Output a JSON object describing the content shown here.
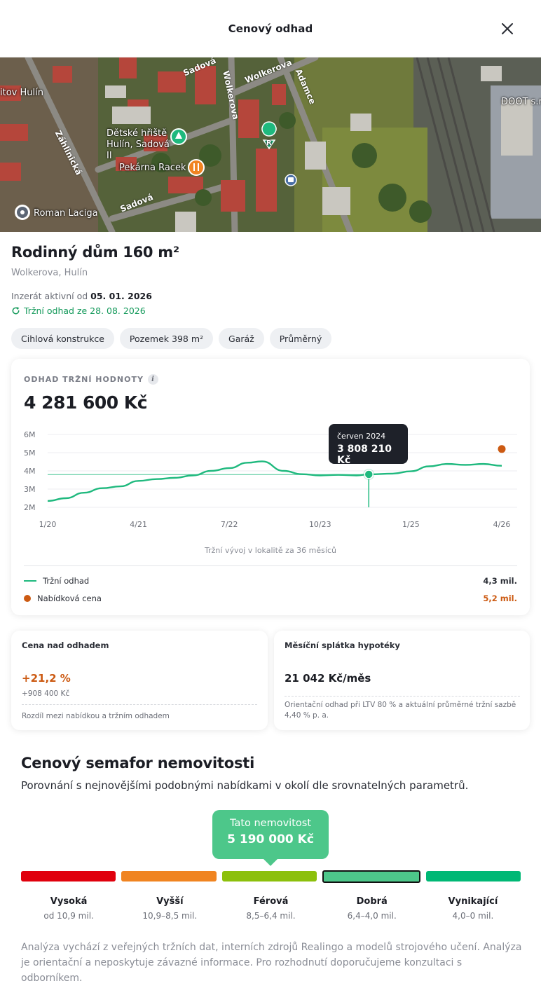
{
  "header": {
    "title": "Cenový odhad"
  },
  "map": {
    "labels": {
      "playground": "Dětské hřiště Hulín, Sadová II",
      "bakery": "Pekárna Racek",
      "person": "Roman Laciga",
      "left_place": "itov Hulín",
      "company": "DOOT s.r"
    },
    "streets": {
      "zahlinicka": "Záhlinická",
      "sadova_top": "Sadová",
      "wolkerova_1": "Wolkerova",
      "wolkerova_2": "Wolkerova",
      "adamce": "Adamce",
      "sadova_bottom": "Sadová"
    },
    "marker_letter": "R"
  },
  "listing": {
    "title": "Rodinný dům 160 m²",
    "address": "Wolkerova, Hulín",
    "active_prefix": "Inzerát aktivní od",
    "active_date": "05. 01. 2026",
    "estimate_text": "Tržní odhad ze 28. 08. 2026"
  },
  "chips": [
    "Cihlová konstrukce",
    "Pozemek 398 m²",
    "Garáž",
    "Průměrný"
  ],
  "valuation": {
    "label": "ODHAD TRŽNÍ HODNOTY",
    "info_glyph": "i",
    "value": "4 281 600 Kč",
    "caption": "Tržní vývoj v lokalitě za 36 měsíců",
    "legend": [
      {
        "name": "Tržní odhad",
        "value": "4,3 mil."
      },
      {
        "name": "Nabídková cena",
        "value": "5,2 mil."
      }
    ],
    "tooltip": {
      "date": "červen 2024",
      "value": "3 808 210 Kč"
    }
  },
  "chart_data": {
    "type": "line",
    "y_ticks": [
      "6M",
      "5M",
      "4M",
      "3M",
      "2M"
    ],
    "y_tick_values": [
      6,
      5,
      4,
      3,
      2
    ],
    "ylim": [
      2,
      6
    ],
    "x_ticks": [
      "1/20",
      "4/21",
      "7/22",
      "10/23",
      "1/25",
      "4/26"
    ],
    "xlim": [
      2020.0,
      2026.25
    ],
    "grid": true,
    "series": [
      {
        "name": "Tržní odhad",
        "color": "#1fb97e",
        "points": [
          [
            2020.0,
            2.35
          ],
          [
            2020.25,
            2.5
          ],
          [
            2020.5,
            2.8
          ],
          [
            2020.75,
            3.05
          ],
          [
            2021.0,
            3.15
          ],
          [
            2021.25,
            3.45
          ],
          [
            2021.5,
            3.55
          ],
          [
            2021.75,
            3.62
          ],
          [
            2022.0,
            3.75
          ],
          [
            2022.25,
            4.0
          ],
          [
            2022.5,
            4.15
          ],
          [
            2022.75,
            4.45
          ],
          [
            2022.95,
            4.52
          ],
          [
            2023.25,
            4.0
          ],
          [
            2023.5,
            3.82
          ],
          [
            2023.75,
            3.75
          ],
          [
            2024.0,
            3.78
          ],
          [
            2024.25,
            3.75
          ],
          [
            2024.42,
            3.81
          ],
          [
            2024.75,
            3.85
          ],
          [
            2025.0,
            3.98
          ],
          [
            2025.25,
            4.25
          ],
          [
            2025.5,
            4.38
          ],
          [
            2025.75,
            4.33
          ],
          [
            2026.0,
            4.38
          ],
          [
            2026.25,
            4.28
          ]
        ]
      },
      {
        "name": "Nabídková cena",
        "color": "#cc5a12",
        "points": [
          [
            2026.25,
            5.2
          ]
        ]
      }
    ],
    "reference_value": 3.8,
    "highlight": {
      "x": 2024.42,
      "y": 3.81,
      "label": "červen 2024",
      "value": "3 808 210 Kč"
    }
  },
  "stats": {
    "above_estimate": {
      "title": "Cena nad odhadem",
      "percent": "+21,2 %",
      "amount": "+908 400 Kč",
      "note": "Rozdíl mezi nabídkou a tržním odhadem"
    },
    "mortgage": {
      "title": "Měsíční splátka hypotéky",
      "value": "21 042 Kč/měs",
      "note": "Orientační odhad při LTV 80 % a aktuální průměrné tržní sazbě 4,40 % p. a."
    }
  },
  "semaphore": {
    "title": "Cenový semafor nemovitosti",
    "subtitle": "Porovnání s nejnovějšími podobnými nabídkami v okolí dle srovnatelných parametrů.",
    "badge_label": "Tato nemovitost",
    "badge_value": "5 190 000 Kč",
    "selected_index": 3,
    "levels": [
      {
        "name": "Vysoká",
        "range": "od 10,9 mil.",
        "color": "#e0000d"
      },
      {
        "name": "Vyšší",
        "range": "10,9–8,5 mil.",
        "color": "#f08421"
      },
      {
        "name": "Férová",
        "range": "8,5–6,4 mil.",
        "color": "#8cc00c"
      },
      {
        "name": "Dobrá",
        "range": "6,4–4,0 mil.",
        "color": "#4dc78a"
      },
      {
        "name": "Vynikající",
        "range": "4,0–0 mil.",
        "color": "#00b875"
      }
    ]
  },
  "disclaimer": "Analýza vychází z veřejných tržních dat, interních zdrojů Realingo a modelů strojového učení. Analýza je orientační a neposkytuje závazné informace. Pro rozhodnutí doporučujeme konzultaci s odborníkem."
}
